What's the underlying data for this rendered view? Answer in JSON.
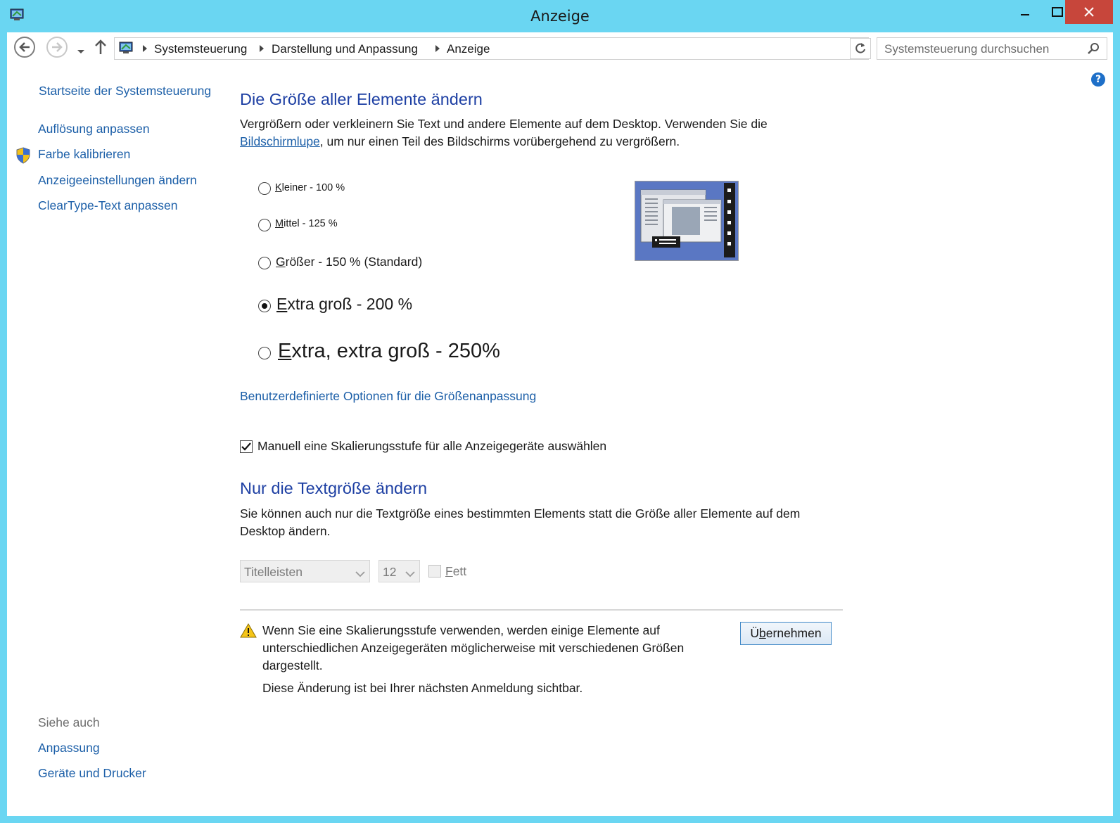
{
  "window": {
    "title": "Anzeige",
    "accent_color": "#6ad6f2",
    "close_color": "#c7463b"
  },
  "navbar": {
    "breadcrumbs": [
      "Systemsteuerung",
      "Darstellung und Anpassung",
      "Anzeige"
    ],
    "search_placeholder": "Systemsteuerung durchsuchen"
  },
  "sidebar": {
    "home_link": "Startseite der Systemsteuerung",
    "links": [
      "Auflösung anpassen",
      "Farbe kalibrieren",
      "Anzeigeeinstellungen ändern",
      "ClearType-Text anpassen"
    ],
    "see_also_heading": "Siehe auch",
    "see_also": [
      "Anpassung",
      "Geräte und Drucker"
    ]
  },
  "main": {
    "heading1": "Die Größe aller Elemente ändern",
    "intro_line1": "Vergrößern oder verkleinern Sie Text und andere Elemente auf dem Desktop. Verwenden Sie die",
    "intro_link": "Bildschirmlupe",
    "intro_line2_rest": ", um nur einen Teil des Bildschirms vorübergehend zu vergrößern.",
    "size_options": [
      {
        "accel": "K",
        "rest": "leiner - 100 %",
        "selected": false
      },
      {
        "accel": "M",
        "rest": "ittel - 125 %",
        "selected": false
      },
      {
        "accel": "G",
        "rest": "rößer - 150 % (Standard)",
        "selected": false
      },
      {
        "accel": "E",
        "rest": "xtra groß - 200 %",
        "selected": true
      },
      {
        "accel": "E",
        "rest": "xtra, extra groß - 250%",
        "selected": false
      }
    ],
    "custom_link": "Benutzerdefinierte Optionen für die Größenanpassung",
    "manual_checkbox_label": "Manuell eine Skalierungsstufe für alle Anzeigegeräte auswählen",
    "manual_checkbox_checked": true,
    "heading2": "Nur die Textgröße ändern",
    "text_intro_line1": "Sie können auch nur die Textgröße eines bestimmten Elements statt die Größe aller Elemente auf dem",
    "text_intro_line2": "Desktop ändern.",
    "element_select": "Titelleisten",
    "size_select": "12",
    "bold_accel": "F",
    "bold_rest": "ett",
    "warning_line1": "Wenn Sie eine Skalierungsstufe verwenden, werden einige Elemente auf",
    "warning_line2": "unterschiedlichen Anzeigegeräten möglicherweise mit verschiedenen Größen",
    "warning_line3": "dargestellt.",
    "notice": "Diese Änderung ist bei Ihrer nächsten Anmeldung sichtbar.",
    "apply_accel_pre": "Ü",
    "apply_accel": "b",
    "apply_rest": "ernehmen"
  }
}
